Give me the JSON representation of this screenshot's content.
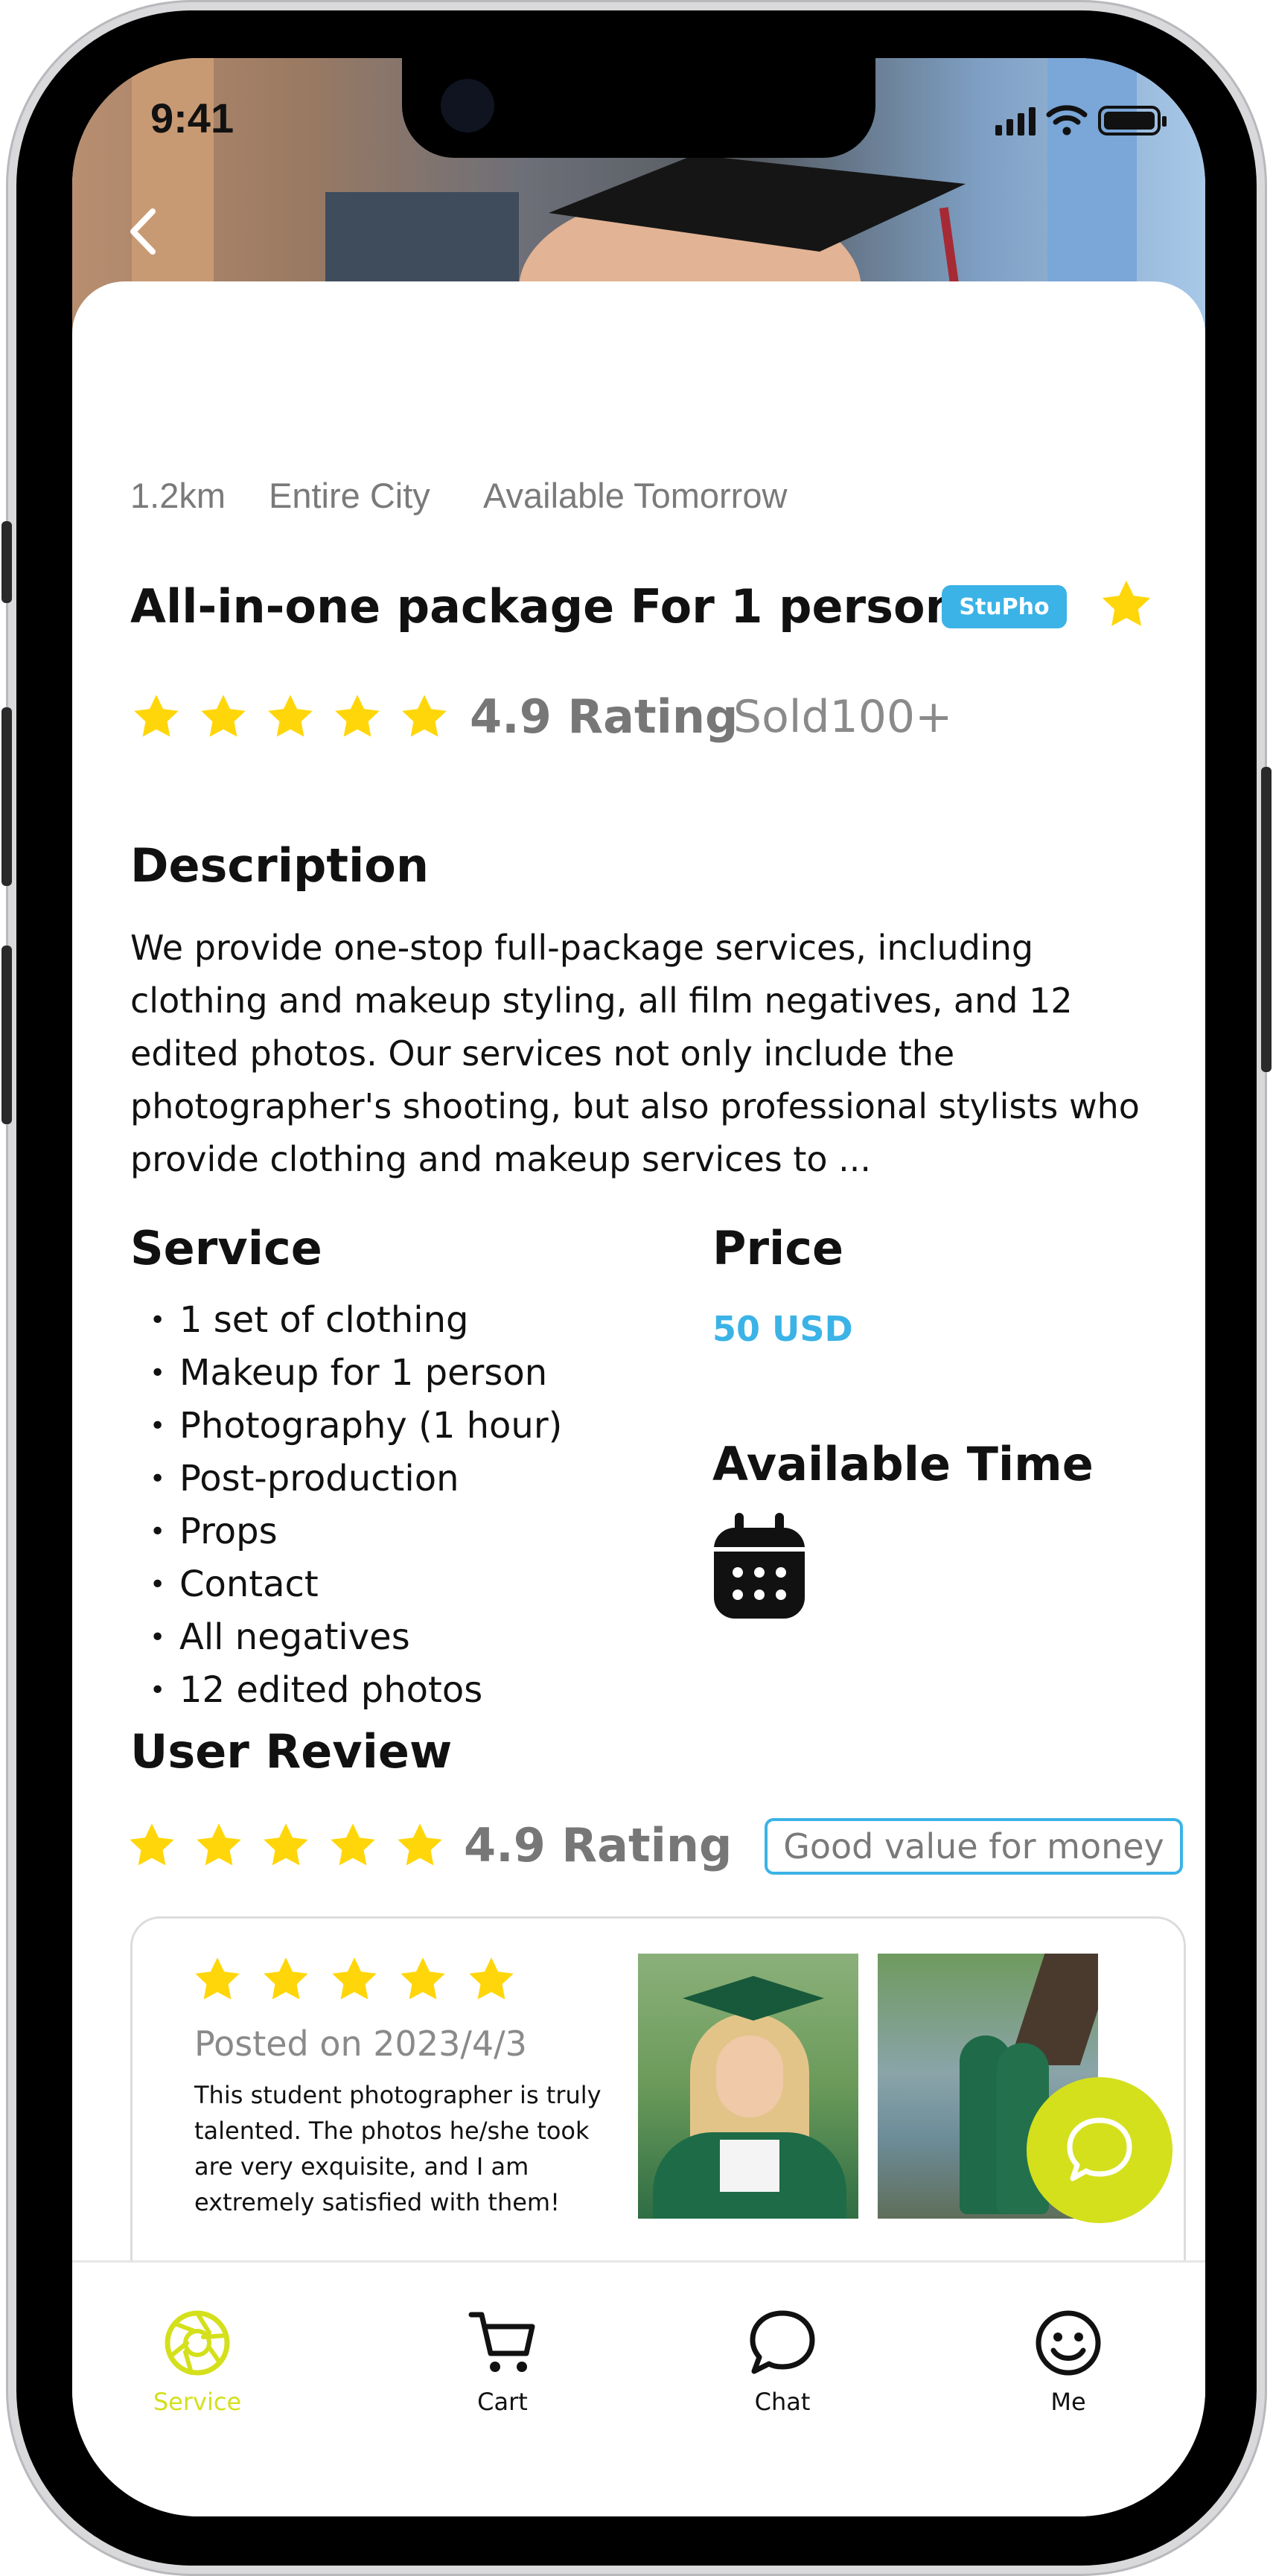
{
  "status_bar": {
    "time": "9:41"
  },
  "header": {
    "back_icon": "chevron-left-icon"
  },
  "service": {
    "meta": {
      "distance": "1.2km",
      "area": "Entire City",
      "availability": "Available Tomorrow"
    },
    "title": "All-in-one package For 1 person",
    "badge": "StuPho",
    "rating": {
      "stars": 5,
      "text": "4.9 Rating",
      "sold": "Sold100+"
    },
    "description_heading": "Description",
    "description": "We provide one-stop full-package services, including clothing and makeup styling, all film negatives, and 12 edited photos. Our services not only include the photographer's shooting, but also professional stylists who provide clothing and makeup services to ...",
    "service_heading": "Service",
    "service_items": [
      "1 set of clothing",
      "Makeup for 1 person",
      "Photography (1 hour)",
      "Post-production",
      "Props",
      "Contact",
      "All negatives",
      "12 edited photos"
    ],
    "price_heading": "Price",
    "price": "50 USD",
    "available_time_heading": "Available Time",
    "calendar_icon": "calendar-icon"
  },
  "reviews": {
    "heading": "User Review",
    "overall_stars": 5,
    "overall_text": "4.9 Rating",
    "tag": "Good value for money",
    "items": [
      {
        "stars": 5,
        "posted": "Posted on 2023/4/3",
        "body": "This student photographer is truly talented. The photos he/she took are very exquisite, and I am extremely satisfied with them!"
      }
    ]
  },
  "fab": {
    "icon": "chat-bubble-icon"
  },
  "bottom_nav": {
    "items": [
      {
        "label": "Service",
        "icon": "camera-aperture-icon",
        "active": true
      },
      {
        "label": "Cart",
        "icon": "cart-icon",
        "active": false
      },
      {
        "label": "Chat",
        "icon": "chat-icon",
        "active": false
      },
      {
        "label": "Me",
        "icon": "smiley-icon",
        "active": false
      }
    ]
  },
  "colors": {
    "accent_blue": "#3bb3e6",
    "accent_lime": "#d4e01c",
    "star_yellow": "#ffd60a",
    "muted_text": "#7a7a7a"
  }
}
